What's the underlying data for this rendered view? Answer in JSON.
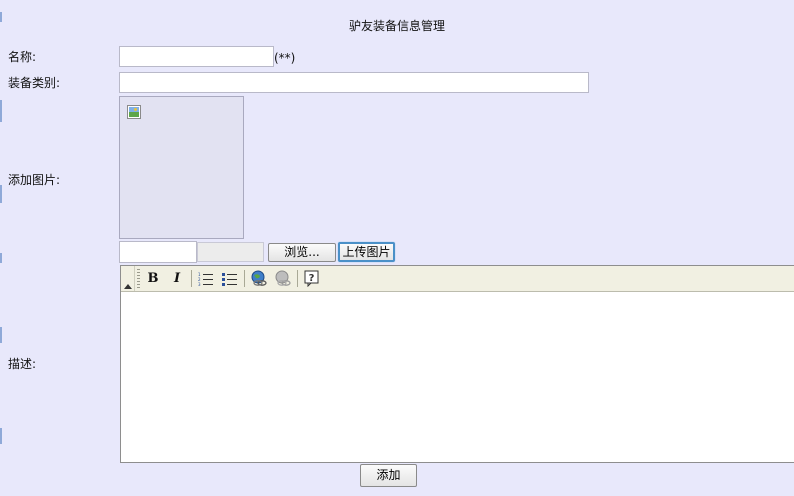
{
  "page": {
    "title": "驴友装备信息管理"
  },
  "form": {
    "name": {
      "label": "名称:",
      "value": "",
      "required_hint": "(**)"
    },
    "category": {
      "label": "装备类别:",
      "value": ""
    },
    "image": {
      "label": "添加图片:",
      "path_value": "",
      "browse_label": "浏览...",
      "upload_label": "上传图片"
    },
    "description": {
      "label": "描述:",
      "toolbar": [
        {
          "name": "bold-button",
          "icon": "bold-icon"
        },
        {
          "name": "italic-button",
          "icon": "italic-icon"
        },
        {
          "name": "ordered-list-button",
          "icon": "ordered-list-icon"
        },
        {
          "name": "unordered-list-button",
          "icon": "unordered-list-icon"
        },
        {
          "name": "insert-link-button",
          "icon": "globe-link-icon"
        },
        {
          "name": "remove-link-button",
          "icon": "unlink-icon"
        },
        {
          "name": "help-button",
          "icon": "help-icon"
        }
      ],
      "content": ""
    },
    "submit_label": "添加"
  }
}
